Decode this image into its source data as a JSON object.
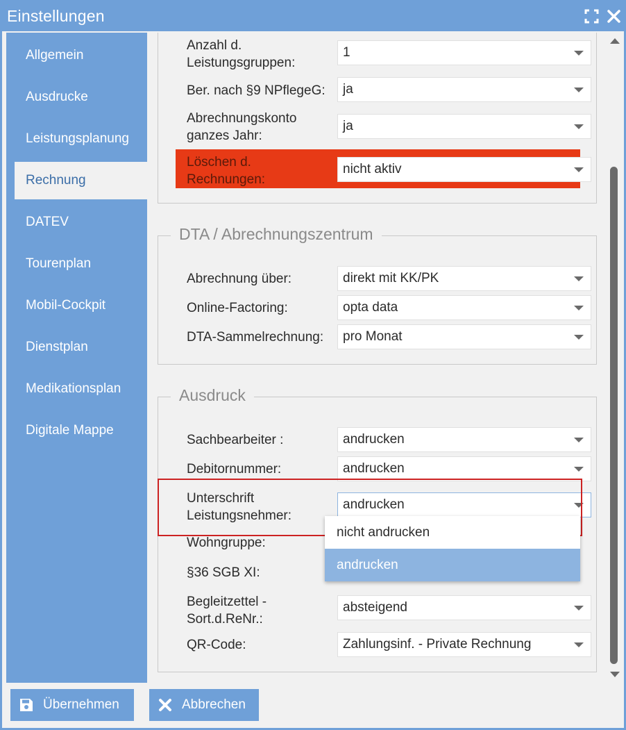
{
  "window": {
    "title": "Einstellungen"
  },
  "sidebar": {
    "items": [
      {
        "label": "Allgemein"
      },
      {
        "label": "Ausdrucke"
      },
      {
        "label": "Leistungsplanung"
      },
      {
        "label": "Rechnung"
      },
      {
        "label": "DATEV"
      },
      {
        "label": "Tourenplan"
      },
      {
        "label": "Mobil-Cockpit"
      },
      {
        "label": "Dienstplan"
      },
      {
        "label": "Medikationsplan"
      },
      {
        "label": "Digitale Mappe"
      }
    ],
    "active": "Rechnung"
  },
  "section_top": {
    "rows": [
      {
        "label_1": "Anzahl d.",
        "label_2": "Leistungsgruppen:",
        "value": "1"
      },
      {
        "label": "Ber. nach §9 NPflegeG:",
        "value": "ja"
      },
      {
        "label_1": "Abrechnungskonto",
        "label_2": "ganzes Jahr:",
        "value": "ja"
      },
      {
        "label_1": "Löschen d.",
        "label_2": "Rechnungen:",
        "value": "nicht aktiv"
      }
    ]
  },
  "section_dta": {
    "legend": "DTA / Abrechnungszentrum",
    "rows": [
      {
        "label": "Abrechnung über:",
        "value": "direkt mit KK/PK"
      },
      {
        "label": "Online-Factoring:",
        "value": "opta data"
      },
      {
        "label": "DTA-Sammelrechnung:",
        "value": "pro Monat"
      }
    ]
  },
  "section_print": {
    "legend": "Ausdruck",
    "rows": [
      {
        "label": "Sachbearbeiter :",
        "value": "andrucken"
      },
      {
        "label": "Debitornummer:",
        "value": "andrucken"
      },
      {
        "label_1": "Unterschrift",
        "label_2": "Leistungsnehmer:",
        "value": "andrucken"
      },
      {
        "label": "Wohngruppe:"
      },
      {
        "label": "§36 SGB XI:"
      },
      {
        "label_1": "Begleitzettel -",
        "label_2": "Sort.d.ReNr.:",
        "value": "absteigend"
      },
      {
        "label": "QR-Code:",
        "value": "Zahlungsinf. - Private Rechnung"
      }
    ]
  },
  "dropdown": {
    "options": [
      "nicht andrucken",
      "andrucken"
    ],
    "selected": "andrucken"
  },
  "footer": {
    "apply_label": "Übernehmen",
    "cancel_label": "Abbrechen"
  },
  "colors": {
    "accent": "#6fa0d8",
    "warning_row": "#e73a16",
    "highlight_border": "#cc2222",
    "dropdown_selected": "#8db4e0"
  }
}
